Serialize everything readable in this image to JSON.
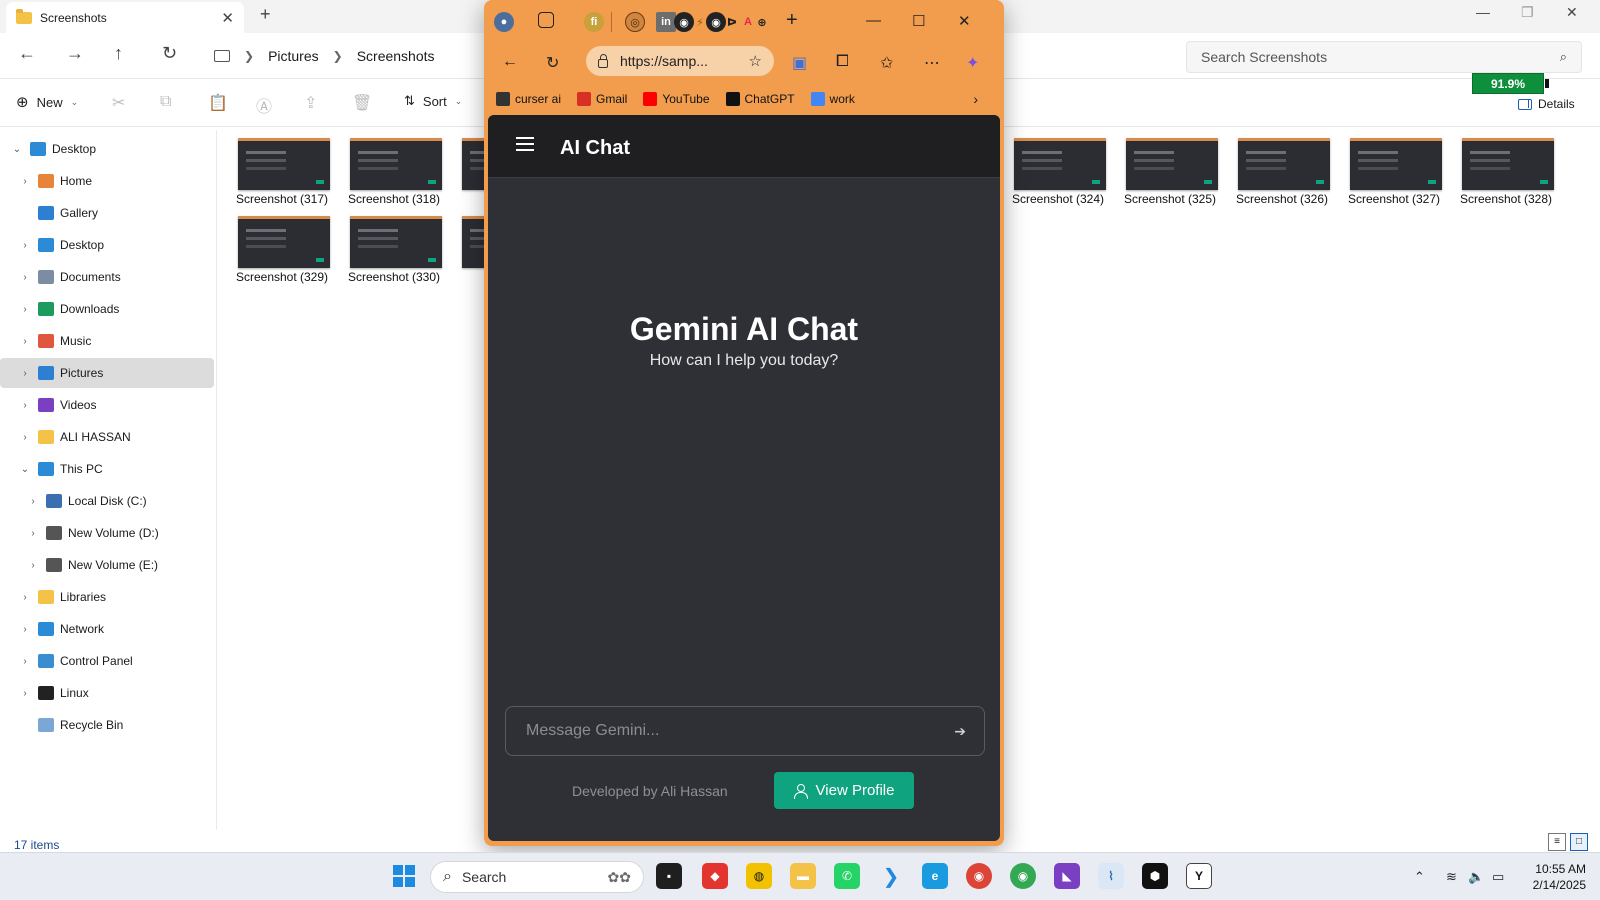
{
  "explorer": {
    "tab_title": "Screenshots",
    "breadcrumb": [
      "Pictures",
      "Screenshots"
    ],
    "search_placeholder": "Search Screenshots",
    "commands": {
      "new": "New",
      "sort": "Sort",
      "details": "Details"
    },
    "battery": "91.9%",
    "nav_items": [
      {
        "label": "Desktop",
        "level": 0,
        "expanded": true,
        "icon": "desktop-icon",
        "color": "#2b8bd6"
      },
      {
        "label": "Home",
        "level": 1,
        "icon": "home-icon",
        "color": "#e8843a"
      },
      {
        "label": "Gallery",
        "level": 1,
        "icon": "gallery-icon",
        "color": "#2e7fd1"
      },
      {
        "label": "Desktop",
        "level": 1,
        "icon": "desktop-icon",
        "color": "#2b8bd6"
      },
      {
        "label": "Documents",
        "level": 1,
        "icon": "documents-icon",
        "color": "#7b8ca3"
      },
      {
        "label": "Downloads",
        "level": 1,
        "icon": "downloads-icon",
        "color": "#1b9b5e"
      },
      {
        "label": "Music",
        "level": 1,
        "icon": "music-icon",
        "color": "#e0563f"
      },
      {
        "label": "Pictures",
        "level": 1,
        "icon": "pictures-icon",
        "color": "#2e7fd1",
        "selected": true
      },
      {
        "label": "Videos",
        "level": 1,
        "icon": "videos-icon",
        "color": "#7b3fc2"
      },
      {
        "label": "ALI HASSAN",
        "level": 1,
        "icon": "folder-icon",
        "color": "#f4c247"
      },
      {
        "label": "This PC",
        "level": 1,
        "expanded": true,
        "icon": "pc-icon",
        "color": "#2b8bd6"
      },
      {
        "label": "Local Disk (C:)",
        "level": 2,
        "icon": "disk-icon",
        "color": "#3a6fb0"
      },
      {
        "label": "New Volume (D:)",
        "level": 2,
        "icon": "drive-icon",
        "color": "#555555"
      },
      {
        "label": "New Volume (E:)",
        "level": 2,
        "icon": "drive-icon",
        "color": "#555555"
      },
      {
        "label": "Libraries",
        "level": 1,
        "icon": "libraries-icon",
        "color": "#f4c247"
      },
      {
        "label": "Network",
        "level": 1,
        "icon": "network-icon",
        "color": "#2b8bd6"
      },
      {
        "label": "Control Panel",
        "level": 1,
        "icon": "control-panel-icon",
        "color": "#3a8ed0"
      },
      {
        "label": "Linux",
        "level": 1,
        "icon": "linux-icon",
        "color": "#222222"
      },
      {
        "label": "Recycle Bin",
        "level": 1,
        "icon": "recycle-bin-icon",
        "color": "#7aa7d6"
      }
    ],
    "thumbnails_row1": [
      "Screenshot (317)",
      "Screenshot (318)",
      "Scr",
      "Screenshot (324)",
      "Screenshot (325)",
      "Screenshot (326)",
      "Screenshot (327)",
      "Screenshot (328)"
    ],
    "thumbnails_row2": [
      "Screenshot (329)",
      "Screenshot (330)",
      "Scr"
    ],
    "partial_caption": "3)",
    "status": "17 items"
  },
  "browser": {
    "url": "https://samp...",
    "bookmarks": [
      {
        "label": "curser ai",
        "icon": "cursor-icon",
        "color": "#333333"
      },
      {
        "label": "Gmail",
        "icon": "gmail-icon",
        "color": "#d93025"
      },
      {
        "label": "YouTube",
        "icon": "youtube-icon",
        "color": "#ff0000"
      },
      {
        "label": "ChatGPT",
        "icon": "chatgpt-icon",
        "color": "#111111"
      },
      {
        "label": "work",
        "icon": "docs-icon",
        "color": "#4285f4"
      }
    ],
    "app": {
      "title": "AI Chat",
      "hero_title": "Gemini AI Chat",
      "hero_subtitle": "How can I help you today?",
      "input_placeholder": "Message Gemini...",
      "developer_credit": "Developed by Ali Hassan",
      "profile_button": "View Profile"
    }
  },
  "taskbar": {
    "search_label": "Search",
    "time": "10:55 AM",
    "date": "2/14/2025"
  }
}
